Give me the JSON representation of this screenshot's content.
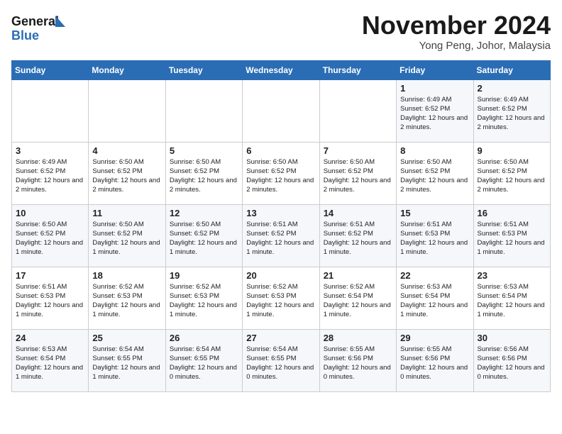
{
  "header": {
    "logo_line1": "General",
    "logo_line2": "Blue",
    "month": "November 2024",
    "location": "Yong Peng, Johor, Malaysia"
  },
  "weekdays": [
    "Sunday",
    "Monday",
    "Tuesday",
    "Wednesday",
    "Thursday",
    "Friday",
    "Saturday"
  ],
  "weeks": [
    [
      {
        "day": "",
        "info": ""
      },
      {
        "day": "",
        "info": ""
      },
      {
        "day": "",
        "info": ""
      },
      {
        "day": "",
        "info": ""
      },
      {
        "day": "",
        "info": ""
      },
      {
        "day": "1",
        "info": "Sunrise: 6:49 AM\nSunset: 6:52 PM\nDaylight: 12 hours and 2 minutes."
      },
      {
        "day": "2",
        "info": "Sunrise: 6:49 AM\nSunset: 6:52 PM\nDaylight: 12 hours and 2 minutes."
      }
    ],
    [
      {
        "day": "3",
        "info": "Sunrise: 6:49 AM\nSunset: 6:52 PM\nDaylight: 12 hours and 2 minutes."
      },
      {
        "day": "4",
        "info": "Sunrise: 6:50 AM\nSunset: 6:52 PM\nDaylight: 12 hours and 2 minutes."
      },
      {
        "day": "5",
        "info": "Sunrise: 6:50 AM\nSunset: 6:52 PM\nDaylight: 12 hours and 2 minutes."
      },
      {
        "day": "6",
        "info": "Sunrise: 6:50 AM\nSunset: 6:52 PM\nDaylight: 12 hours and 2 minutes."
      },
      {
        "day": "7",
        "info": "Sunrise: 6:50 AM\nSunset: 6:52 PM\nDaylight: 12 hours and 2 minutes."
      },
      {
        "day": "8",
        "info": "Sunrise: 6:50 AM\nSunset: 6:52 PM\nDaylight: 12 hours and 2 minutes."
      },
      {
        "day": "9",
        "info": "Sunrise: 6:50 AM\nSunset: 6:52 PM\nDaylight: 12 hours and 2 minutes."
      }
    ],
    [
      {
        "day": "10",
        "info": "Sunrise: 6:50 AM\nSunset: 6:52 PM\nDaylight: 12 hours and 1 minute."
      },
      {
        "day": "11",
        "info": "Sunrise: 6:50 AM\nSunset: 6:52 PM\nDaylight: 12 hours and 1 minute."
      },
      {
        "day": "12",
        "info": "Sunrise: 6:50 AM\nSunset: 6:52 PM\nDaylight: 12 hours and 1 minute."
      },
      {
        "day": "13",
        "info": "Sunrise: 6:51 AM\nSunset: 6:52 PM\nDaylight: 12 hours and 1 minute."
      },
      {
        "day": "14",
        "info": "Sunrise: 6:51 AM\nSunset: 6:52 PM\nDaylight: 12 hours and 1 minute."
      },
      {
        "day": "15",
        "info": "Sunrise: 6:51 AM\nSunset: 6:53 PM\nDaylight: 12 hours and 1 minute."
      },
      {
        "day": "16",
        "info": "Sunrise: 6:51 AM\nSunset: 6:53 PM\nDaylight: 12 hours and 1 minute."
      }
    ],
    [
      {
        "day": "17",
        "info": "Sunrise: 6:51 AM\nSunset: 6:53 PM\nDaylight: 12 hours and 1 minute."
      },
      {
        "day": "18",
        "info": "Sunrise: 6:52 AM\nSunset: 6:53 PM\nDaylight: 12 hours and 1 minute."
      },
      {
        "day": "19",
        "info": "Sunrise: 6:52 AM\nSunset: 6:53 PM\nDaylight: 12 hours and 1 minute."
      },
      {
        "day": "20",
        "info": "Sunrise: 6:52 AM\nSunset: 6:53 PM\nDaylight: 12 hours and 1 minute."
      },
      {
        "day": "21",
        "info": "Sunrise: 6:52 AM\nSunset: 6:54 PM\nDaylight: 12 hours and 1 minute."
      },
      {
        "day": "22",
        "info": "Sunrise: 6:53 AM\nSunset: 6:54 PM\nDaylight: 12 hours and 1 minute."
      },
      {
        "day": "23",
        "info": "Sunrise: 6:53 AM\nSunset: 6:54 PM\nDaylight: 12 hours and 1 minute."
      }
    ],
    [
      {
        "day": "24",
        "info": "Sunrise: 6:53 AM\nSunset: 6:54 PM\nDaylight: 12 hours and 1 minute."
      },
      {
        "day": "25",
        "info": "Sunrise: 6:54 AM\nSunset: 6:55 PM\nDaylight: 12 hours and 1 minute."
      },
      {
        "day": "26",
        "info": "Sunrise: 6:54 AM\nSunset: 6:55 PM\nDaylight: 12 hours and 0 minutes."
      },
      {
        "day": "27",
        "info": "Sunrise: 6:54 AM\nSunset: 6:55 PM\nDaylight: 12 hours and 0 minutes."
      },
      {
        "day": "28",
        "info": "Sunrise: 6:55 AM\nSunset: 6:56 PM\nDaylight: 12 hours and 0 minutes."
      },
      {
        "day": "29",
        "info": "Sunrise: 6:55 AM\nSunset: 6:56 PM\nDaylight: 12 hours and 0 minutes."
      },
      {
        "day": "30",
        "info": "Sunrise: 6:56 AM\nSunset: 6:56 PM\nDaylight: 12 hours and 0 minutes."
      }
    ]
  ]
}
